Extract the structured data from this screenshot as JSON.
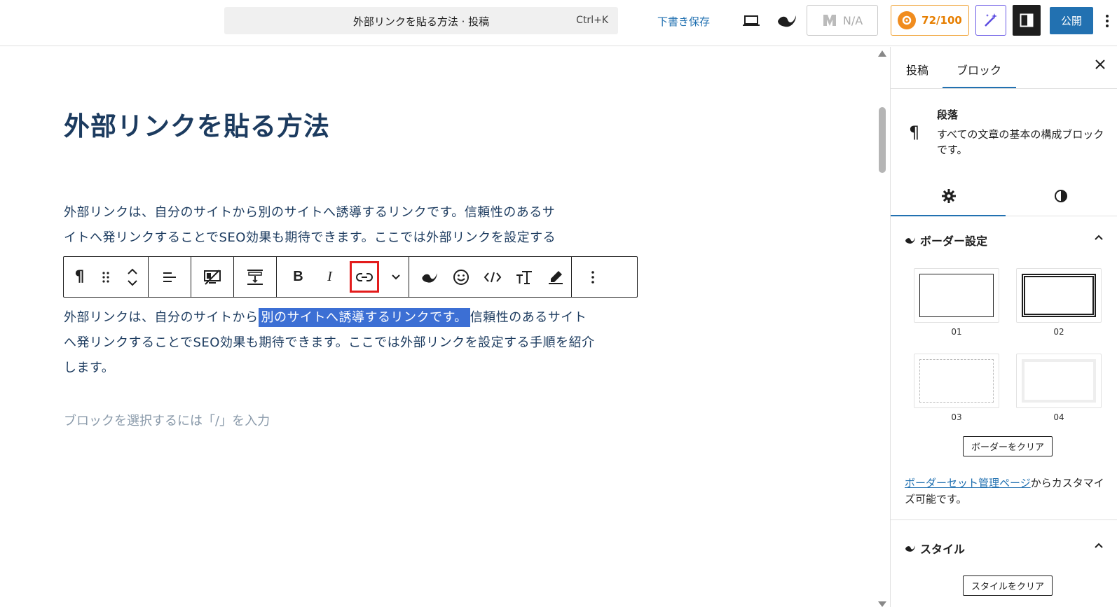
{
  "header": {
    "command_title": "外部リンクを貼る方法 · 投稿",
    "command_shortcut": "Ctrl+K",
    "save_draft": "下書き保存",
    "na_label": "N/A",
    "score_label": "72/100",
    "publish_label": "公開"
  },
  "editor": {
    "post_title": "外部リンクを貼る方法",
    "para1_line1": "外部リンクは、自分のサイトから別のサイトへ誘導するリンクです。信頼性のあるサ",
    "para1_line2": "イトへ発リンクすることでSEO効果も期待できます。ここでは外部リンクを設定する",
    "para2_before": "外部リンクは、自分のサイトから",
    "para2_selected": "別のサイトへ誘導するリンクです。",
    "para2_after": "信頼性のあるサイトへ発リンクすることでSEO効果も期待できます。ここでは外部リンクを設定する手順を紹介します。",
    "placeholder": "ブロックを選択するには「/」を入力"
  },
  "toolbar": {
    "bold": "B",
    "italic": "I",
    "pilcrow": "¶",
    "highlighted_button": "link-icon"
  },
  "sidebar": {
    "tab_post": "投稿",
    "tab_block": "ブロック",
    "block_title": "段落",
    "block_desc": "すべての文章の基本の構成ブロックです。",
    "border_section": "ボーダー設定",
    "swatches": [
      "01",
      "02",
      "03",
      "04"
    ],
    "clear_border": "ボーダーをクリア",
    "note_link": "ボーダーセット管理ページ",
    "note_text": "からカスタマイズ可能です。",
    "style_section": "スタイル",
    "clear_style": "スタイルをクリア"
  },
  "colors": {
    "accent": "#2271b1",
    "title_text": "#1c3b5f",
    "selection": "#3c6fd4",
    "highlight_box": "#e31c1c",
    "score_orange": "#e67e00"
  }
}
